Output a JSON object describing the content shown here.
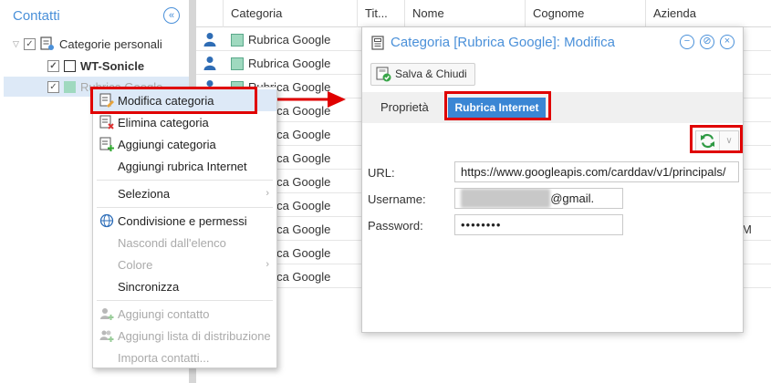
{
  "sidebar": {
    "title": "Contatti",
    "collapse_glyph": "«",
    "tree": [
      {
        "label": "Categorie personali",
        "toggle": "▽",
        "checked": true,
        "icon": "category-folder-icon"
      },
      {
        "label": "WT-Sonicle",
        "checked": true,
        "swatch": "#ffffff"
      },
      {
        "label": "Rubrica Google",
        "checked": true,
        "swatch": "#9fd9bf",
        "selected": true
      }
    ]
  },
  "grid": {
    "columns": [
      "",
      "Categoria",
      "Tit...",
      "Nome",
      "Cognome",
      "Azienda"
    ],
    "rows": [
      {
        "category": "Rubrica Google"
      },
      {
        "category": "Rubrica Google"
      },
      {
        "category": "Rubrica Google"
      },
      {
        "category": "Rubrica Google"
      },
      {
        "category": "Rubrica Google"
      },
      {
        "category": "Rubrica Google"
      },
      {
        "category": "Rubrica Google"
      },
      {
        "category": "Rubrica Google"
      },
      {
        "category": "Rubrica Google",
        "extra": "M"
      },
      {
        "category": "Rubrica Google"
      },
      {
        "category": "Rubrica Google"
      }
    ]
  },
  "context_menu": {
    "items": [
      {
        "label": "Modifica categoria",
        "icon": "edit-category-icon",
        "enabled": true,
        "highlighted": true
      },
      {
        "label": "Elimina categoria",
        "icon": "delete-category-icon",
        "enabled": true
      },
      {
        "label": "Aggiungi categoria",
        "icon": "add-category-icon",
        "enabled": true
      },
      {
        "label": "Aggiungi rubrica Internet",
        "enabled": true
      },
      {
        "label": "Seleziona",
        "enabled": true,
        "submenu": true
      },
      {
        "label": "Condivisione e permessi",
        "icon": "globe-icon",
        "enabled": true
      },
      {
        "label": "Nascondi dall'elenco",
        "enabled": false
      },
      {
        "label": "Colore",
        "enabled": false,
        "submenu": true
      },
      {
        "label": "Sincronizza",
        "enabled": true
      },
      {
        "label": "Aggiungi contatto",
        "icon": "add-contact-icon",
        "enabled": false
      },
      {
        "label": "Aggiungi lista di distribuzione",
        "icon": "add-distribution-list-icon",
        "enabled": false
      },
      {
        "label": "Importa contatti...",
        "enabled": false
      }
    ],
    "chevron": "›"
  },
  "dialog": {
    "title": "Categoria [Rubrica Google]: Modifica",
    "minimize_glyph": "−",
    "pin_glyph": "⊘",
    "close_glyph": "×",
    "save_close_label": "Salva & Chiudi",
    "tabs": [
      {
        "label": "Proprietà",
        "active": false
      },
      {
        "label": "Rubrica Internet",
        "active": true
      }
    ],
    "sync_dropdown_glyph": "∨",
    "fields": {
      "url": {
        "label": "URL:",
        "value": "https://www.googleapis.com/carddav/v1/principals/"
      },
      "username": {
        "label": "Username:",
        "value_visible": "@gmail."
      },
      "password": {
        "label": "Password:",
        "value": "••••••••"
      }
    }
  },
  "colors": {
    "accent": "#4a90d9",
    "active_tab": "#3a86d4",
    "highlight": "#e00000",
    "category_green": "#9fd9bf"
  }
}
